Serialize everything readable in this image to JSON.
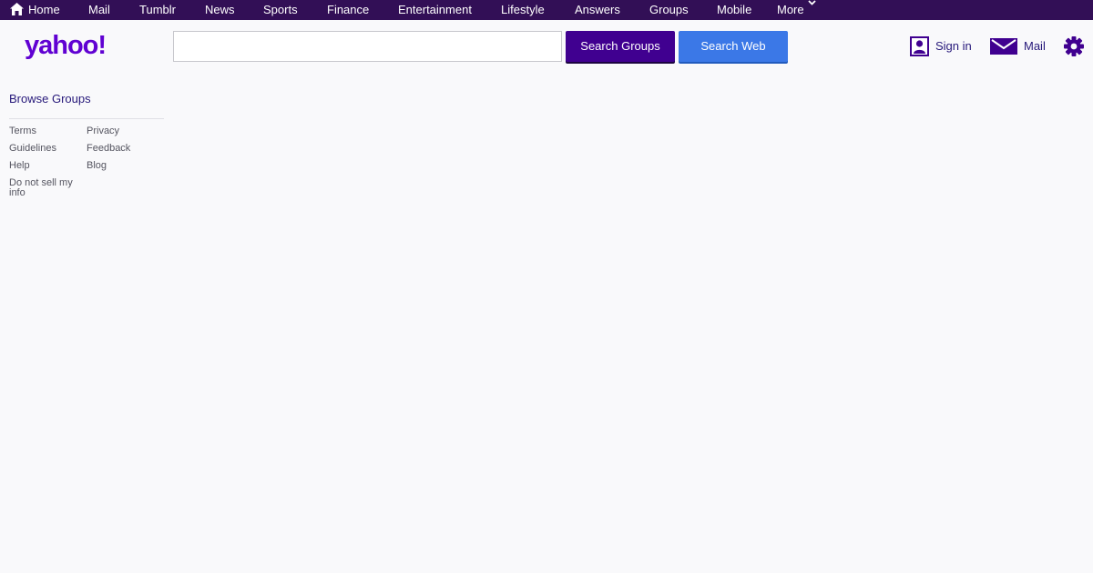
{
  "topnav": {
    "items": [
      {
        "label": "Home"
      },
      {
        "label": "Mail"
      },
      {
        "label": "Tumblr"
      },
      {
        "label": "News"
      },
      {
        "label": "Sports"
      },
      {
        "label": "Finance"
      },
      {
        "label": "Entertainment"
      },
      {
        "label": "Lifestyle"
      },
      {
        "label": "Answers"
      },
      {
        "label": "Groups"
      },
      {
        "label": "Mobile"
      },
      {
        "label": "More"
      }
    ],
    "background": "#320f56"
  },
  "header": {
    "logo_text": "yahoo!",
    "logo_color": "#6001d2",
    "search": {
      "value": "",
      "placeholder": ""
    },
    "search_groups_label": "Search Groups",
    "search_web_label": "Search Web",
    "signin_label": "Sign in",
    "mail_label": "Mail",
    "icons": [
      "home-icon",
      "user-icon",
      "mail-icon",
      "gear-icon",
      "chevron-down-icon"
    ]
  },
  "sidebar": {
    "browse_groups_label": "Browse Groups",
    "footer_links": [
      {
        "label": "Terms"
      },
      {
        "label": "Privacy"
      },
      {
        "label": "Guidelines"
      },
      {
        "label": "Feedback"
      },
      {
        "label": "Help"
      },
      {
        "label": "Blog"
      },
      {
        "label": "Do not sell my info"
      }
    ]
  },
  "colors": {
    "accent_purple": "#400090",
    "accent_blue": "#3b78e7",
    "link": "#26187a",
    "page_background": "#f9f9fb"
  }
}
